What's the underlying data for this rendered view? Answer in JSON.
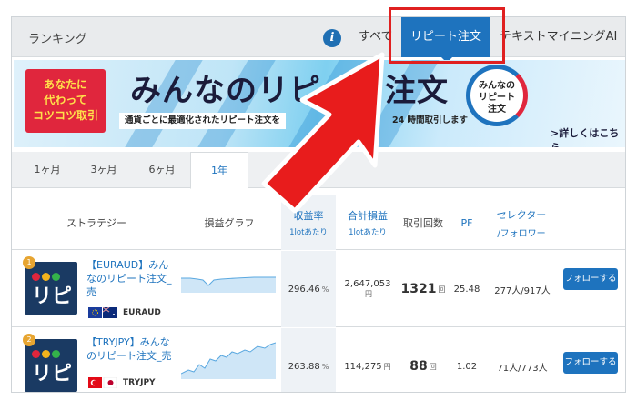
{
  "header": {
    "title": "ランキング",
    "tabs": [
      "すべて",
      "リピート注文",
      "テキストマイニングAI"
    ]
  },
  "banner": {
    "badge_lines": [
      "あなたに",
      "代わって",
      "コツコツ取引"
    ],
    "headline": "みんなのリピート注文",
    "subline_left": "通貨ごとに最適化されたリピート注文を",
    "subline_right": "24 時間取引します",
    "logo_lines": [
      "みんなの",
      "リピート",
      "注文"
    ],
    "more_link": ">詳しくはこちら"
  },
  "periods": [
    "1ヶ月",
    "3ヶ月",
    "6ヶ月",
    "1年"
  ],
  "table": {
    "headers": {
      "strategy": "ストラテジー",
      "graph": "損益グラフ",
      "return": "収益率",
      "return_sub": "1lotあたり",
      "total": "合計損益",
      "total_sub": "1lotあたり",
      "trades": "取引回数",
      "pf": "PF",
      "selector1": "セレクター",
      "selector2": "/フォロワー"
    },
    "rows": [
      {
        "rank": "1",
        "name": "【EURAUD】みんなのリピート注文_売",
        "pair": "EURAUD",
        "return_value": "296.46",
        "return_unit": "%",
        "total_value": "2,647,053",
        "total_unit": "円",
        "trades_value": "1321",
        "trades_unit": "回",
        "pf": "25.48",
        "selectors": "277人/917人",
        "follow_label": "フォローする"
      },
      {
        "rank": "2",
        "name": "【TRYJPY】みんなのリピート注文_売",
        "pair": "TRYJPY",
        "return_value": "263.88",
        "return_unit": "%",
        "total_value": "114,275",
        "total_unit": "円",
        "trades_value": "88",
        "trades_unit": "回",
        "pf": "1.02",
        "selectors": "71人/773人",
        "follow_label": "フォローする"
      }
    ]
  },
  "logo_text": "リピ",
  "colors": {
    "accent": "#1e73be",
    "highlight": "#e02020",
    "badge": "#e0263d",
    "rank": "#e7a531"
  }
}
